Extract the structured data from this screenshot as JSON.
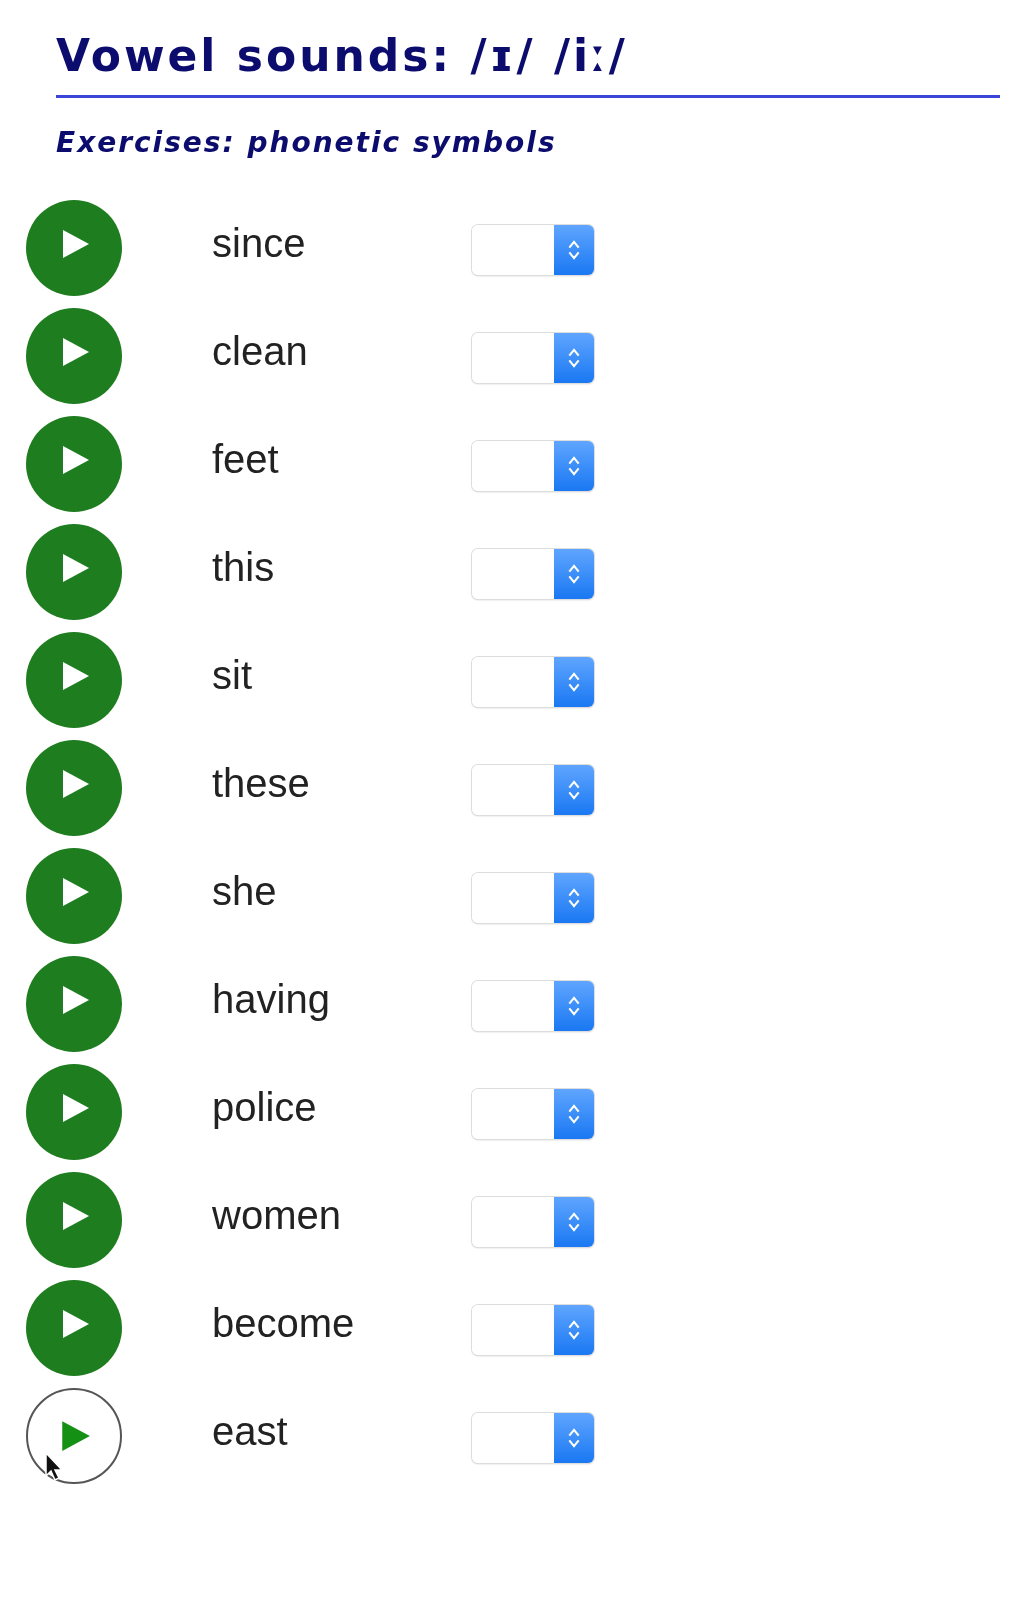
{
  "title": "Vowel sounds: /ɪ/ /iː/",
  "subtitle": "Exercises: phonetic symbols",
  "rows": [
    {
      "word": "since",
      "hovered": false
    },
    {
      "word": "clean",
      "hovered": false
    },
    {
      "word": "feet",
      "hovered": false
    },
    {
      "word": "this",
      "hovered": false
    },
    {
      "word": "sit",
      "hovered": false
    },
    {
      "word": "these",
      "hovered": false
    },
    {
      "word": "she",
      "hovered": false
    },
    {
      "word": "having",
      "hovered": false
    },
    {
      "word": "police",
      "hovered": false
    },
    {
      "word": "women",
      "hovered": false
    },
    {
      "word": "become",
      "hovered": false
    },
    {
      "word": "east",
      "hovered": true
    }
  ]
}
